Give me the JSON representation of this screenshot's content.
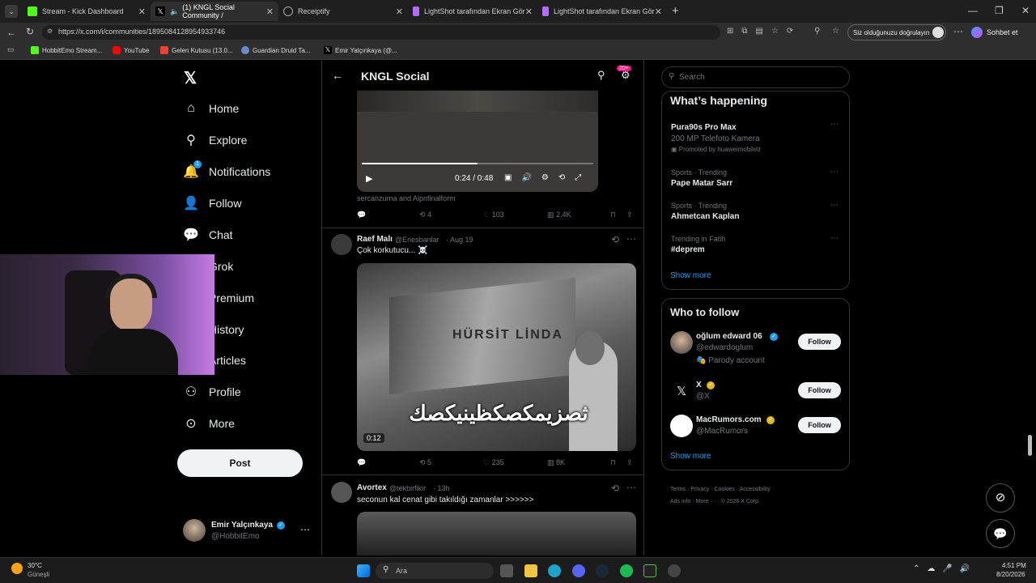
{
  "browser": {
    "tabs": [
      {
        "label": "Stream - Kick Dashboard",
        "color": "#53fc18"
      },
      {
        "label": "(1) KNGL Social Community /",
        "color": "#ffffff"
      },
      {
        "label": "Receiptify",
        "color": "#aaaaaa"
      },
      {
        "label": "LightShot tarafından Ekran Görünt",
        "color": "#b46cff"
      },
      {
        "label": "LightShot tarafından Ekran Görünt",
        "color": "#b46cff"
      }
    ],
    "url": "https://x.com/i/communities/1895084128954933746",
    "profile_label": "Siz olduğunuzu doğrulayın",
    "copilot_label": "Sohbet et",
    "bookmarks": [
      "HobbitEmo Stream...",
      "YouTube",
      "Gelen Kutusu (13.0...",
      "Guardian Druid Ta...",
      "Emir Yalçınkaya (@..."
    ]
  },
  "nav": {
    "items": [
      "Home",
      "Explore",
      "Notifications",
      "Follow",
      "Chat",
      "Grok",
      "Premium",
      "History",
      "Articles",
      "Profile",
      "More"
    ],
    "notification_badge": "1",
    "post_label": "Post",
    "account_name": "Emir Yalçınkaya",
    "account_handle": "@HobbitEmo"
  },
  "feed": {
    "header_title": "KNGL Social",
    "header_badge": "20+",
    "video1": {
      "time": "0:24 / 0:48",
      "progress": 0.5,
      "credit": "sercanzurna and Alpnfinalform"
    },
    "post1_actions": {
      "reply": "",
      "retweet": "4",
      "like": "103",
      "views": "2.4K"
    },
    "post2": {
      "name": "Raef Malı",
      "handle": "@Enesbanlar",
      "date": "· Aug 19",
      "text": "Çok korkutucu... ☠️",
      "overlay_text": "ثصزيمكصكظينيكصك",
      "sign_text": "HÜRSİT LİNDA",
      "duration": "0:12",
      "actions": {
        "reply": "",
        "retweet": "5",
        "like": "235",
        "views": "8K"
      }
    },
    "post3": {
      "name": "Avortex",
      "handle": "@tekbirfikir",
      "date": "· 13h",
      "text": "seconun kal cenat gibi takıldığı zamanlar >>>>>>"
    }
  },
  "right": {
    "search_placeholder": "Search",
    "happening_title": "What’s happening",
    "trends": [
      {
        "context": "",
        "title": "Pura90s Pro Max",
        "sub": "200 MP Telefoto Kamera",
        "promo": "Promoted by huaweimobiletr"
      },
      {
        "context": "Sports · Trending",
        "title": "Pape Matar Sarr",
        "sub": "",
        "promo": ""
      },
      {
        "context": "Sports · Trending",
        "title": "Ahmetcan Kaplan",
        "sub": "",
        "promo": ""
      },
      {
        "context": "Trending in Fatih",
        "title": "#deprem",
        "sub": "",
        "promo": ""
      }
    ],
    "show_more": "Show more",
    "who_title": "Who to follow",
    "who": [
      {
        "name": "oğlum edward 06",
        "handle": "@edwardoglum",
        "extra": "Parody account",
        "badge": "#1d9bf0"
      },
      {
        "name": "X",
        "handle": "@X",
        "extra": "",
        "badge": "#e2b719"
      },
      {
        "name": "MacRumors.com",
        "handle": "@MacRumors",
        "extra": "",
        "badge": "#e2b719"
      }
    ],
    "follow_label": "Follow",
    "footer1": [
      "Terms",
      "Privacy",
      "Cookies",
      "Accessibility"
    ],
    "footer2": [
      "Ads info",
      "More ···",
      "© 2026 X Corp."
    ]
  },
  "taskbar": {
    "weather_temp": "30°C",
    "weather_desc": "Güneşli",
    "search_placeholder": "Ara",
    "time": "4:51 PM",
    "date": "8/20/2026"
  }
}
